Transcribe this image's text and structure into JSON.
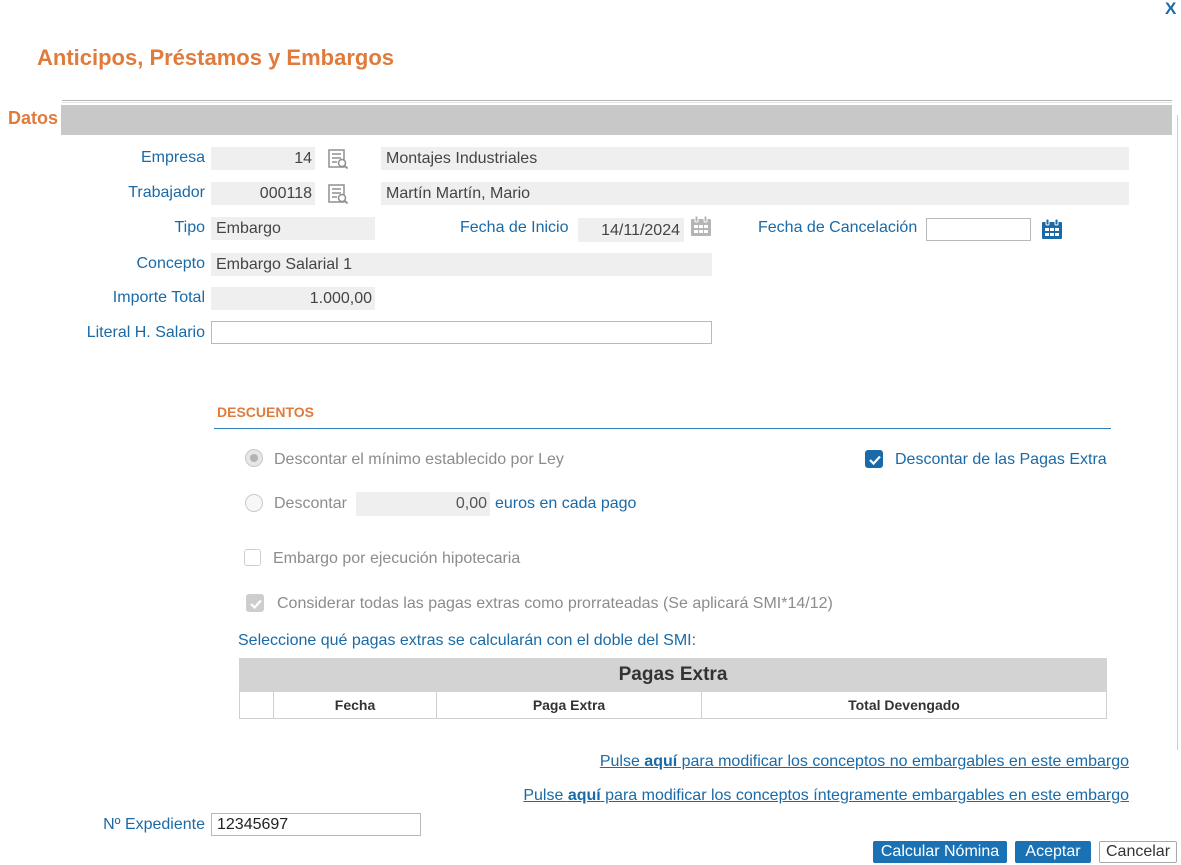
{
  "window": {
    "title": "Anticipos, Préstamos y Embargos",
    "close_label": "X"
  },
  "section": {
    "title": "Datos"
  },
  "form": {
    "empresa": {
      "label": "Empresa",
      "code": "14",
      "name": "Montajes Industriales"
    },
    "trabajador": {
      "label": "Trabajador",
      "code": "000118",
      "name": "Martín Martín, Mario"
    },
    "tipo": {
      "label": "Tipo",
      "value": "Embargo"
    },
    "fecha_inicio": {
      "label": "Fecha de Inicio",
      "value": "14/11/2024"
    },
    "fecha_cancelacion": {
      "label": "Fecha de Cancelación",
      "value": ""
    },
    "concepto": {
      "label": "Concepto",
      "value": "Embargo Salarial 1"
    },
    "importe_total": {
      "label": "Importe Total",
      "value": "1.000,00"
    },
    "literal": {
      "label": "Literal H. Salario",
      "value": ""
    }
  },
  "descuentos": {
    "title": "DESCUENTOS",
    "minimo_ley": {
      "label": "Descontar el mínimo establecido por Ley",
      "selected": true
    },
    "descontar_importe": {
      "label": "Descontar",
      "value": "0,00",
      "suffix": "euros en cada pago",
      "selected": false
    },
    "pagas_extra": {
      "label": "Descontar de las Pagas Extra",
      "checked": true
    },
    "hipotecaria": {
      "label": "Embargo por ejecución hipotecaria",
      "checked": false
    },
    "prorrateadas": {
      "label": "Considerar todas las pagas extras como prorrateadas (Se aplicará SMI*14/12)",
      "checked": true
    },
    "seleccione_label": "Seleccione qué pagas extras se calcularán con el doble del SMI:"
  },
  "pagas_table": {
    "title": "Pagas Extra",
    "columns": [
      "Fecha",
      "Paga Extra",
      "Total Devengado"
    ],
    "rows": []
  },
  "links": [
    {
      "prefix": "Pulse ",
      "bold": "aquí",
      "suffix": " para modificar los conceptos no embargables en este embargo"
    },
    {
      "prefix": "Pulse ",
      "bold": "aquí",
      "suffix": " para modificar los conceptos íntegramente embargables en este embargo"
    }
  ],
  "expediente": {
    "label": "Nº Expediente",
    "value": "12345697"
  },
  "buttons": {
    "calcular": "Calcular Nómina",
    "aceptar": "Aceptar",
    "cancelar": "Cancelar"
  },
  "icons": {
    "lookup": "lookup-list-icon",
    "calendar": "calendar-icon",
    "close": "close-icon"
  },
  "colors": {
    "accent_orange": "#e07b3c",
    "label_blue": "#1a6aa7",
    "button_blue": "#1a72b5",
    "field_gray": "#efefef",
    "disabled_text": "#8c8c8c"
  }
}
